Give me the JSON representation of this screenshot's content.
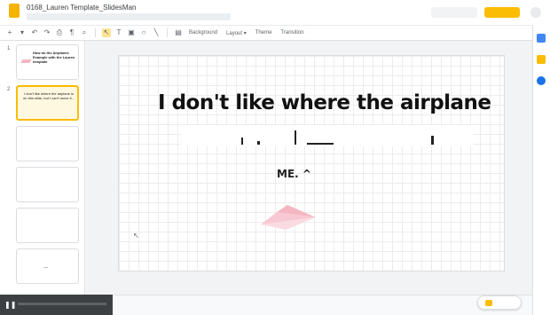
{
  "window": {
    "title": "0168_Lauren Template_SlidesMan"
  },
  "toolbar": {
    "items": [
      "Background",
      "Layout ▾",
      "Theme",
      "Transition"
    ]
  },
  "filmstrip": {
    "slides": [
      {
        "number": "1",
        "text": "How do the Airplanes Example with the Lauren template"
      },
      {
        "number": "2",
        "text": "I don't like where the airplane is on this slide, but I can't move it..."
      },
      {
        "number": "",
        "text": ""
      },
      {
        "number": "",
        "text": ""
      },
      {
        "number": "",
        "text": ""
      },
      {
        "number": "",
        "text": "—"
      }
    ]
  },
  "slide": {
    "title": "I don't like where the airplane",
    "line3": "ME. ^"
  },
  "colors": {
    "accent": "#fbbc04",
    "plane": "#f4b6c2"
  }
}
